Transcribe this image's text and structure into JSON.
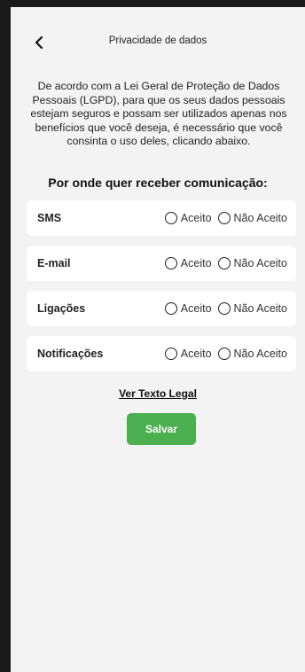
{
  "header": {
    "title": "Privacidade de dados",
    "back_icon": "chevron-left-icon"
  },
  "intro": "De acordo com a Lei Geral de Proteção de Dados Pessoais (LGPD), para que os seus dados pessoais estejam seguros e possam ser utilizados apenas nos benefícios que você deseja, é necessário que você consinta o uso deles, clicando abaixo.",
  "section_title": "Por onde quer receber comunicação:",
  "channels": [
    {
      "label": "SMS",
      "accept": "Aceito",
      "decline": "Não Aceito",
      "selected": null
    },
    {
      "label": "E-mail",
      "accept": "Aceito",
      "decline": "Não Aceito",
      "selected": null
    },
    {
      "label": "Ligações",
      "accept": "Aceito",
      "decline": "Não Aceito",
      "selected": null
    },
    {
      "label": "Notificações",
      "accept": "Aceito",
      "decline": "Não Aceito",
      "selected": null
    }
  ],
  "legal_link": "Ver Texto Legal",
  "save_label": "Salvar",
  "colors": {
    "background": "#f3f3f3",
    "card": "#ffffff",
    "accent": "#4caf50",
    "frame": "#1a1a1a"
  }
}
